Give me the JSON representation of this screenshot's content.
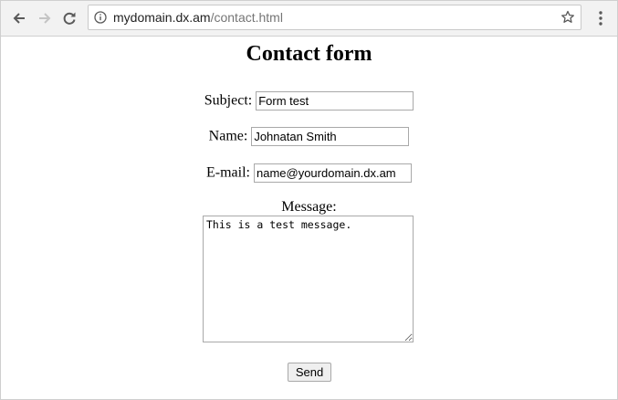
{
  "browser": {
    "url_host": "mydomain.dx.am",
    "url_path": "/contact.html"
  },
  "page": {
    "title": "Contact form",
    "fields": {
      "subject": {
        "label": "Subject:",
        "value": "Form test"
      },
      "name": {
        "label": "Name:",
        "value": "Johnatan Smith"
      },
      "email": {
        "label": "E-mail:",
        "value": "name@yourdomain.dx.am"
      },
      "message": {
        "label": "Message:",
        "value": "This is a test message."
      }
    },
    "send_label": "Send"
  },
  "icons": {
    "back": "back-arrow-icon",
    "forward": "forward-arrow-icon",
    "reload": "reload-icon",
    "info": "info-icon",
    "bookmark": "star-icon",
    "menu": "kebab-menu-icon"
  }
}
